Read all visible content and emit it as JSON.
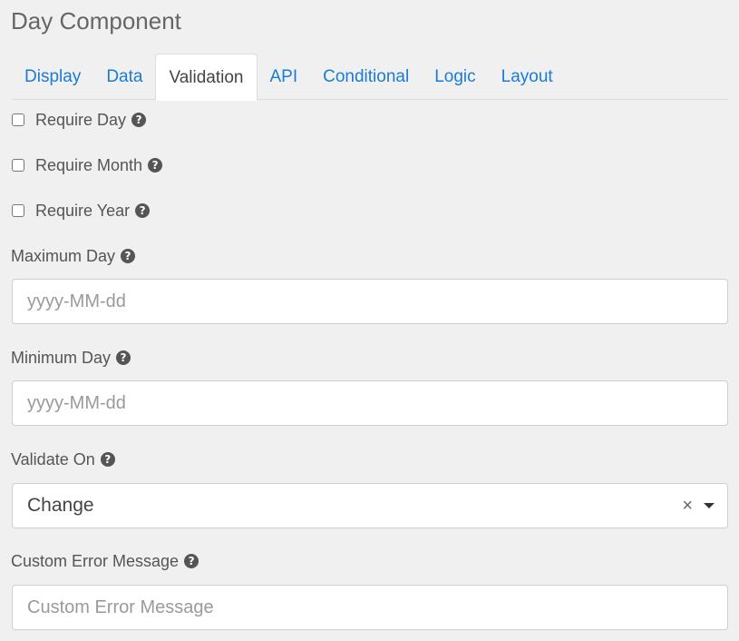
{
  "page": {
    "title": "Day Component"
  },
  "tabs": [
    {
      "label": "Display"
    },
    {
      "label": "Data"
    },
    {
      "label": "Validation"
    },
    {
      "label": "API"
    },
    {
      "label": "Conditional"
    },
    {
      "label": "Logic"
    },
    {
      "label": "Layout"
    }
  ],
  "active_tab": "Validation",
  "checkboxes": {
    "require_day": {
      "label": "Require Day",
      "checked": false
    },
    "require_month": {
      "label": "Require Month",
      "checked": false
    },
    "require_year": {
      "label": "Require Year",
      "checked": false
    }
  },
  "fields": {
    "maximum_day": {
      "label": "Maximum Day",
      "value": "",
      "placeholder": "yyyy-MM-dd"
    },
    "minimum_day": {
      "label": "Minimum Day",
      "value": "",
      "placeholder": "yyyy-MM-dd"
    },
    "validate_on": {
      "label": "Validate On",
      "value": "Change"
    },
    "custom_error_message": {
      "label": "Custom Error Message",
      "value": "",
      "placeholder": "Custom Error Message"
    }
  },
  "icons": {
    "help": "question-circle-icon",
    "clear": "×",
    "dropdown": "caret-down-icon"
  },
  "colors": {
    "background": "#f0f0f0",
    "tab_link": "#1a7bd4",
    "text": "#555555",
    "input_border": "#cfcfcf"
  }
}
